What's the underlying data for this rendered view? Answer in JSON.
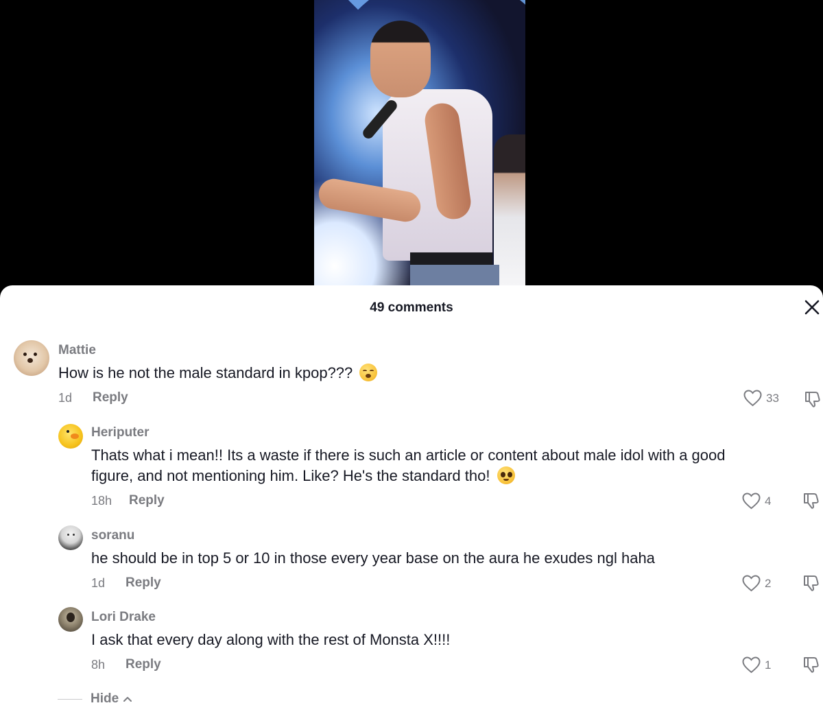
{
  "sheet": {
    "title": "49 comments",
    "close_icon": "close-icon"
  },
  "comments": [
    {
      "username": "Mattie",
      "text": "How is he not the male standard in kpop???",
      "emoji": "exhausted-face",
      "time": "1d",
      "reply_label": "Reply",
      "likes": "33"
    },
    {
      "username": "Heriputer",
      "text_line1": "Thats what i mean!! Its a waste if there is such an article or content about male idol with a good",
      "text_line2": "figure, and not mentioning him. Like? He's the standard tho!",
      "emoji": "pleading-face",
      "time": "18h",
      "reply_label": "Reply",
      "likes": "4"
    },
    {
      "username": "soranu",
      "text": "he should be in top 5 or 10 in those every year base on the aura he exudes ngl haha",
      "time": "1d",
      "reply_label": "Reply",
      "likes": "2"
    },
    {
      "username": "Lori Drake",
      "text": "I ask that every day along with the rest of Monsta X!!!!",
      "time": "8h",
      "reply_label": "Reply",
      "likes": "1"
    }
  ],
  "hide_label": "Hide",
  "colors": {
    "text": "#161823",
    "muted": "#7a7b80",
    "sheet_bg": "#ffffff"
  }
}
